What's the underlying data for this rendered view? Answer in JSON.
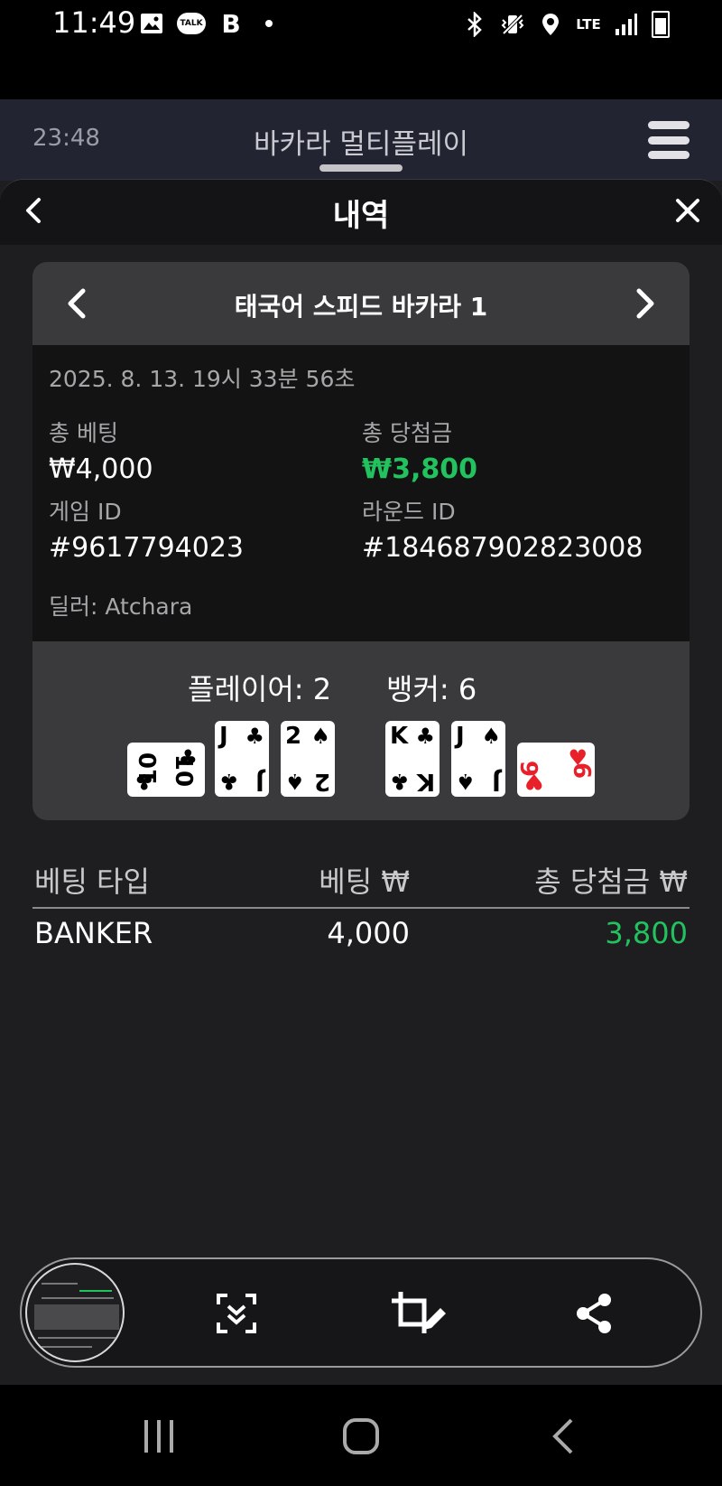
{
  "status_bar": {
    "time": "11:49",
    "left_icons": [
      "gallery-icon",
      "kakaotalk-icon",
      "b-app-icon",
      "dot-icon"
    ],
    "talk_label": "TALK",
    "b_label": "B",
    "network_label": "LTE",
    "right_icons": [
      "bluetooth-icon",
      "vibrate-icon",
      "location-icon",
      "lte-icon",
      "signal-icon",
      "battery-icon"
    ]
  },
  "app_header": {
    "clock": "23:48",
    "title": "바카라 멀티플레이",
    "menu_icon": "hamburger-menu-icon"
  },
  "sheet": {
    "title": "내역",
    "back_icon": "chevron-left-icon",
    "close_icon": "close-icon"
  },
  "history_card": {
    "table_name": "태국어 스피드 바카라 1",
    "date": "2025. 8. 13. 19시 33분 56초",
    "total_bet_label": "총 베팅",
    "total_bet_value": "₩4,000",
    "total_win_label": "총 당첨금",
    "total_win_value": "₩3,800",
    "game_id_label": "게임 ID",
    "game_id_value": "#9617794023",
    "round_id_label": "라운드 ID",
    "round_id_value": "#184687902823008",
    "dealer_text": "딜러: Atchara",
    "player_score": "플레이어: 2",
    "banker_score": "뱅커: 6",
    "player_cards": [
      {
        "rank": "10",
        "suit": "♣",
        "color": "#000000",
        "orientation": "sideways"
      },
      {
        "rank": "J",
        "suit": "♣",
        "color": "#000000",
        "orientation": "upright"
      },
      {
        "rank": "2",
        "suit": "♠",
        "color": "#000000",
        "orientation": "upright"
      }
    ],
    "banker_cards": [
      {
        "rank": "K",
        "suit": "♣",
        "color": "#000000",
        "orientation": "upright"
      },
      {
        "rank": "J",
        "suit": "♠",
        "color": "#000000",
        "orientation": "upright"
      },
      {
        "rank": "6",
        "suit": "♥",
        "color": "#e8202a",
        "orientation": "sideways"
      }
    ]
  },
  "bets_table": {
    "headers": [
      "베팅 타입",
      "베팅 ₩",
      "총 당첨금 ₩"
    ],
    "rows": [
      {
        "type": "BANKER",
        "bet": "4,000",
        "win": "3,800"
      }
    ]
  },
  "capture_toolbar": {
    "buttons": [
      "scroll-capture-icon",
      "crop-edit-icon",
      "share-icon"
    ]
  },
  "nav_bar": {
    "buttons": [
      "recent-apps-icon",
      "home-icon",
      "back-icon"
    ]
  },
  "colors": {
    "win_green": "#22c35e",
    "background": "#1e1e20",
    "panel_gray": "#3a3a3c",
    "heart_red": "#e8202a"
  }
}
